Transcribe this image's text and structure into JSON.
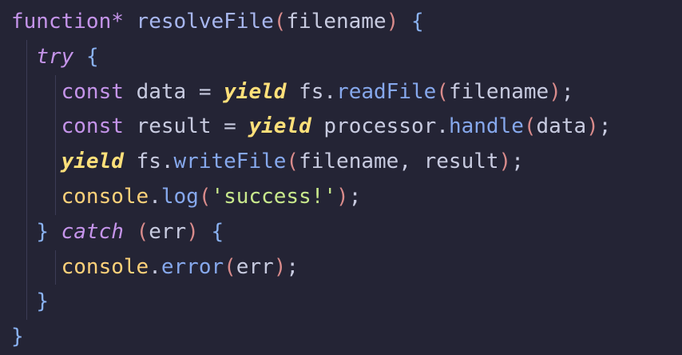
{
  "code": {
    "line1": {
      "kw_function": "function*",
      "fn_name": "resolveFile",
      "open_paren": "(",
      "param": "filename",
      "close_paren": ")",
      "open_brace": "{"
    },
    "line2": {
      "kw_try": "try",
      "open_brace": "{"
    },
    "line3": {
      "kw_const": "const",
      "var": "data",
      "op": "=",
      "kw_yield": "yield",
      "obj": "fs",
      "dot": ".",
      "method": "readFile",
      "open_paren": "(",
      "arg": "filename",
      "close_paren": ")",
      "semi": ";"
    },
    "line4": {
      "kw_const": "const",
      "var": "result",
      "op": "=",
      "kw_yield": "yield",
      "obj": "processor",
      "dot": ".",
      "method": "handle",
      "open_paren": "(",
      "arg": "data",
      "close_paren": ")",
      "semi": ";"
    },
    "line5": {
      "kw_yield": "yield",
      "obj": "fs",
      "dot": ".",
      "method": "writeFile",
      "open_paren": "(",
      "arg1": "filename",
      "comma": ",",
      "arg2": "result",
      "close_paren": ")",
      "semi": ";"
    },
    "line6": {
      "obj": "console",
      "dot": ".",
      "method": "log",
      "open_paren": "(",
      "string": "'success!'",
      "close_paren": ")",
      "semi": ";"
    },
    "line7": {
      "close_brace": "}",
      "kw_catch": "catch",
      "open_paren": "(",
      "param": "err",
      "close_paren": ")",
      "open_brace": "{"
    },
    "line8": {
      "obj": "console",
      "dot": ".",
      "method": "error",
      "open_paren": "(",
      "arg": "err",
      "close_paren": ")",
      "semi": ";"
    },
    "line9": {
      "close_brace": "}"
    },
    "line10": {
      "close_brace": "}"
    }
  },
  "colors": {
    "background": "#242435",
    "keyword": "#c594ea",
    "yield": "#ffe07a",
    "function": "#a7b6ee",
    "method": "#86a8ec",
    "object": "#ffd27a",
    "string": "#c9e98c",
    "paren": "#d98b8b",
    "brace": "#8ab2f2",
    "text": "#c8cbe0"
  }
}
